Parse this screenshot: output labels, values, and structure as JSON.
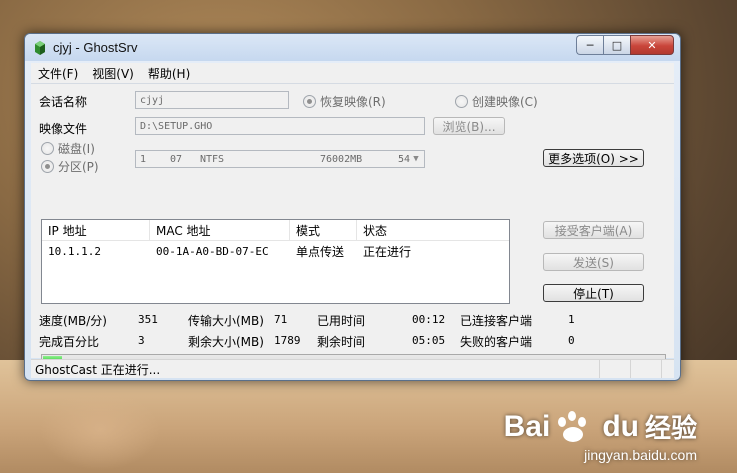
{
  "window": {
    "title": "cjyj - GhostSrv",
    "buttons": {
      "minimize": "─",
      "maximize": "□",
      "close": "✕"
    }
  },
  "menu": {
    "items": [
      "文件(F)",
      "视图(V)",
      "帮助(H)"
    ]
  },
  "session": {
    "name_label": "会话名称",
    "name_value": "cjyj",
    "image_file_label": "映像文件",
    "image_file_value": "D:\\SETUP.GHO",
    "restore_label": "恢复映像(R)",
    "create_label": "创建映像(C)",
    "browse_label": "浏览(B)...",
    "disk_label": "磁盘(I)",
    "partition_label": "分区(P)",
    "partition": {
      "num": "1",
      "id": "07",
      "fs": "NTFS",
      "size": "76002MB",
      "extra": "54"
    }
  },
  "buttons": {
    "more_options": "更多选项(O) >>",
    "accept_clients": "接受客户端(A)",
    "send": "发送(S)",
    "stop": "停止(T)"
  },
  "clients_table": {
    "headers": [
      "IP 地址",
      "MAC 地址",
      "模式",
      "状态"
    ],
    "rows": [
      {
        "ip": "10.1.1.2",
        "mac": "00-1A-A0-BD-07-EC",
        "mode": "单点传送",
        "status": "正在进行"
      }
    ]
  },
  "stats": {
    "speed_label": "速度(MB/分)",
    "speed_value": "351",
    "transfer_label": "传输大小(MB)",
    "transfer_value": "71",
    "elapsed_label": "已用时间",
    "elapsed_value": "00:12",
    "connected_label": "已连接客户端",
    "connected_value": "1",
    "percent_label": "完成百分比",
    "percent_value": "3",
    "remaining_label": "剩余大小(MB)",
    "remaining_value": "1789",
    "time_left_label": "剩余时间",
    "time_left_value": "05:05",
    "failed_label": "失败的客户端",
    "failed_value": "0"
  },
  "progress": {
    "fraction": 0.03
  },
  "statusbar": {
    "text": "GhostCast 正在进行..."
  },
  "watermark": {
    "brand": "Bai",
    "brand2": "du",
    "product": "经验",
    "url": "jingyan.baidu.com"
  }
}
